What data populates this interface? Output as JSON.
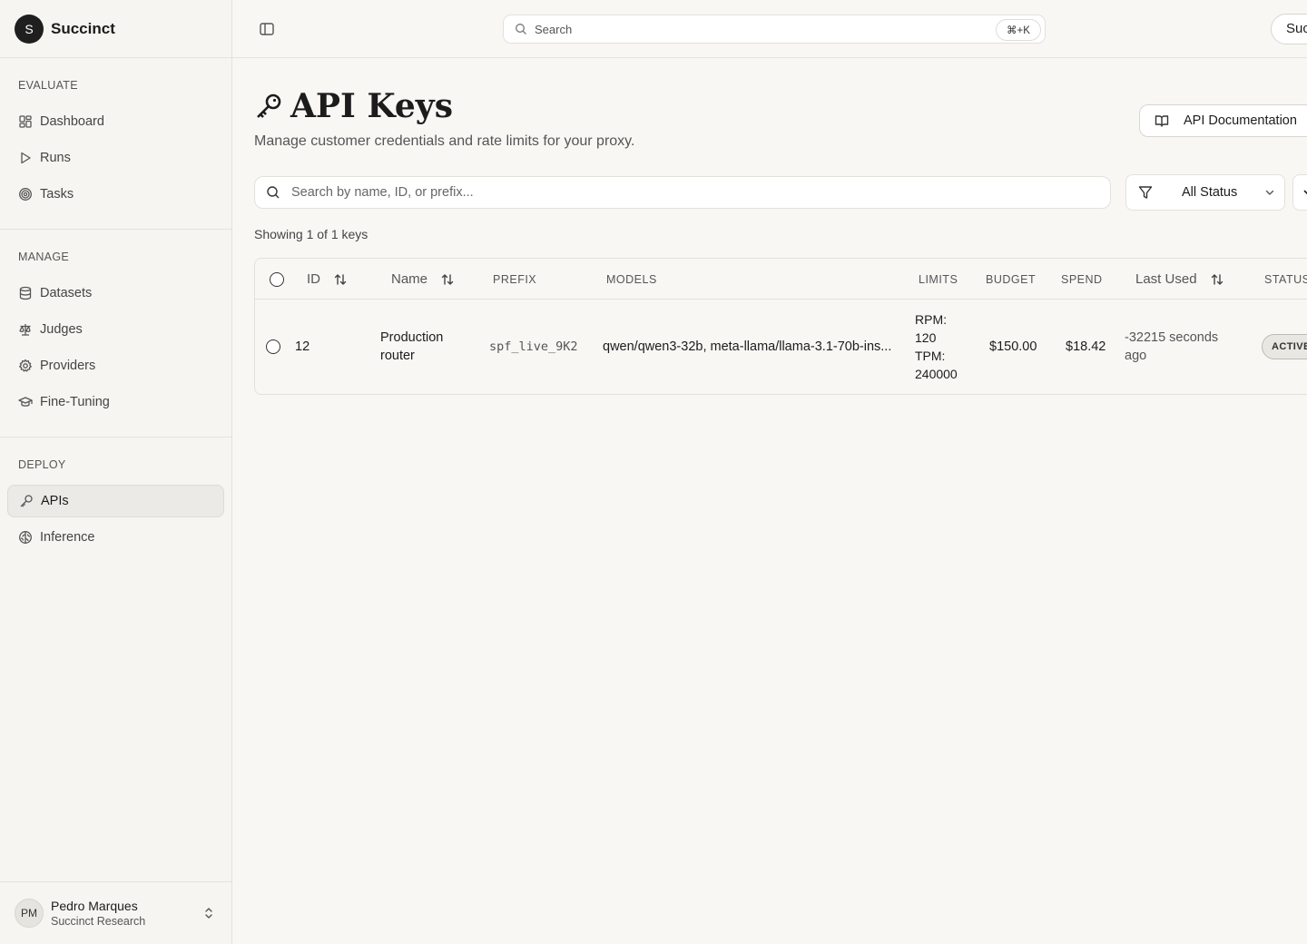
{
  "brand": {
    "logo_letter": "S",
    "name": "Succinct"
  },
  "sidebar": {
    "sections": [
      {
        "title": "EVALUATE",
        "items": [
          {
            "label": "Dashboard",
            "icon": "dashboard-icon"
          },
          {
            "label": "Runs",
            "icon": "play-icon"
          },
          {
            "label": "Tasks",
            "icon": "target-icon"
          }
        ]
      },
      {
        "title": "MANAGE",
        "items": [
          {
            "label": "Datasets",
            "icon": "database-icon"
          },
          {
            "label": "Judges",
            "icon": "scale-icon"
          },
          {
            "label": "Providers",
            "icon": "gear-icon"
          },
          {
            "label": "Fine-Tuning",
            "icon": "graduation-cap-icon"
          }
        ]
      },
      {
        "title": "DEPLOY",
        "items": [
          {
            "label": "APIs",
            "icon": "key-icon",
            "active": true
          },
          {
            "label": "Inference",
            "icon": "brain-icon"
          }
        ]
      }
    ],
    "user": {
      "initials": "PM",
      "name": "Pedro Marques",
      "org": "Succinct Research"
    }
  },
  "topbar": {
    "search_placeholder": "Search",
    "shortcut": "⌘+K",
    "right_button_label": "Succinct"
  },
  "page": {
    "title": "API Keys",
    "subtitle": "Manage customer credentials and rate limits for your proxy.",
    "docs_button": "API Documentation",
    "search_placeholder": "Search by name, ID, or prefix...",
    "status_filter": "All Status",
    "showing": "Showing 1 of 1 keys"
  },
  "table": {
    "columns": {
      "id": "ID",
      "name": "Name",
      "prefix": "PREFIX",
      "models": "MODELS",
      "limits": "LIMITS",
      "budget": "BUDGET",
      "spend": "SPEND",
      "last_used": "Last Used",
      "status": "STATUS"
    },
    "rows": [
      {
        "id": "12",
        "name_line1": "Production",
        "name_line2": "router",
        "prefix": "spf_live_9K2",
        "models": "qwen/qwen3-32b, meta-llama/llama-3.1-70b-ins...",
        "rpm_label": "RPM:",
        "rpm_value": "120",
        "tpm_label": "TPM:",
        "tpm_value": "240000",
        "budget": "$150.00",
        "spend": "$18.42",
        "last_used_line1": "-32215 seconds",
        "last_used_line2": "ago",
        "status": "ACTIVE"
      }
    ]
  }
}
